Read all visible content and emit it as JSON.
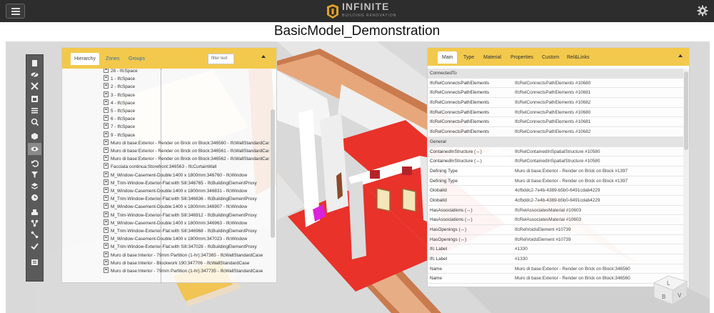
{
  "app": {
    "logo_text": "INFINITE",
    "logo_sub": "BUILDING RENOVATION",
    "menu_icon": "hamburger-icon",
    "settings_icon": "gear-icon"
  },
  "page_title": "BasicModel_Demonstration",
  "colors": {
    "accent": "#f2c94c",
    "topbar": "#2d2d2d",
    "toolbar": "#5a5a5a",
    "link": "#2d6ea8"
  },
  "toolbar": {
    "icons": [
      "document-icon",
      "eye-slash-icon",
      "cross-arrows-icon",
      "window-icon",
      "list-icon",
      "zoom-icon",
      "cube-icon",
      "eye-icon",
      "undo-icon",
      "filter-icon",
      "layers-icon",
      "clock-icon",
      "structure-icon",
      "share-icon",
      "connect-icon",
      "check-icon",
      "export-icon"
    ]
  },
  "left_panel": {
    "tabs": [
      {
        "label": "Hierarchy"
      },
      {
        "label": "Zones"
      },
      {
        "label": "Groups"
      }
    ],
    "filter_placeholder": "filter text",
    "tree": [
      "28 - IfcSpace",
      "1 - IfcSpace",
      "2 - IfcSpace",
      "3 - IfcSpace",
      "4 - IfcSpace",
      "5 - IfcSpace",
      "6 - IfcSpace",
      "7 - IfcSpace",
      "9 - IfcSpace",
      "Muro di base:Exterior - Render on Brick on Block:346560 - IfcWallStandardCase",
      "Muro di base:Exterior - Render on Brick on Block:346561 - IfcWallStandardCase",
      "Muro di base:Exterior - Render on Brick on Block:346562 - IfcWallStandardCase",
      "Facciata continua:Storefront:346563 - IfcCurtainWall",
      "M_Window-Casement-Double:1400 x 1800mm:346760 - IfcWindow",
      "M_Trim-Window-Exterior-Flat:with Sill:346765 - IfcBuildingElementProxy",
      "M_Window-Casement-Double:1400 x 1800mm:346831 - IfcWindow",
      "M_Trim-Window-Exterior-Flat:with Sill:346836 - IfcBuildingElementProxy",
      "M_Window-Casement-Double:1400 x 1800mm:346907 - IfcWindow",
      "M_Trim-Window-Exterior-Flat:with Sill:346912 - IfcBuildingElementProxy",
      "M_Window-Casement-Double:1400 x 1800mm:346963 - IfcWindow",
      "M_Trim-Window-Exterior-Flat:with Sill:346968 - IfcBuildingElementProxy",
      "M_Window-Casement-Double:1400 x 1800mm:347023 - IfcWindow",
      "M_Trim-Window-Exterior-Flat:with Sill:347028 - IfcBuildingElementProxy",
      "Muro di base:Interior - 79mm Partition (1-hr):347365 - IfcWallStandardCase",
      "Muro di base:Interior - Blockwork 190:347706 - IfcWallStandardCase",
      "Muro di base:Interior - 79mm Partition (1-hr):347735 - IfcWallStandardCase"
    ]
  },
  "right_panel": {
    "tabs": [
      {
        "label": "Main"
      },
      {
        "label": "Type"
      },
      {
        "label": "Material"
      },
      {
        "label": "Properties"
      },
      {
        "label": "Custom"
      },
      {
        "label": "Rel&Links"
      }
    ],
    "rows": [
      {
        "section": "ConnectedTo"
      },
      {
        "key": "IfcRelConnectsPathElements",
        "value": "IfcRelConnectsPathElements #10680"
      },
      {
        "key": "IfcRelConnectsPathElements",
        "value": "IfcRelConnectsPathElements #10681"
      },
      {
        "key": "IfcRelConnectsPathElements",
        "value": "IfcRelConnectsPathElements #10682"
      },
      {
        "key": "IfcRelConnectsPathElements",
        "value": "IfcRelConnectsPathElements #10680"
      },
      {
        "key": "IfcRelConnectsPathElements",
        "value": "IfcRelConnectsPathElements #10681"
      },
      {
        "key": "IfcRelConnectsPathElements",
        "value": "IfcRelConnectsPathElements #10682"
      },
      {
        "section": "General"
      },
      {
        "key": "ContainedInStructure (↔)",
        "value": "IfcRelContainedInSpatialStructure #10580"
      },
      {
        "key": "ContainedInStructure (↔)",
        "value": "IfcRelContainedInSpatialStructure #10580"
      },
      {
        "key": "Defining Type",
        "value": "Muro di base:Exterior - Render on Brick on Block #1397"
      },
      {
        "key": "Defining Type",
        "value": "Muro di base:Exterior - Render on Brick on Block #1397"
      },
      {
        "key": "GlobalId",
        "value": "4cfbddc2-7e4b-4389-b5b0-6491cdab4229"
      },
      {
        "key": "GlobalId",
        "value": "4cfbddc2-7e4b-4389-b5b0-6491cdab4229"
      },
      {
        "key": "HasAssociations (↔)",
        "value": "IfcRelAssociatesMaterial #10603"
      },
      {
        "key": "HasAssociations (↔)",
        "value": "IfcRelAssociatesMaterial #10603"
      },
      {
        "key": "HasOpenings (↔)",
        "value": "IfcRelVoidsElement #10739"
      },
      {
        "key": "HasOpenings (↔)",
        "value": "IfcRelVoidsElement #10739"
      },
      {
        "key": "Ifc Label",
        "value": "#1330"
      },
      {
        "key": "Ifc Label",
        "value": "#1330"
      },
      {
        "key": "Name",
        "value": "Muro di base:Exterior - Render on Brick on Block:346560"
      },
      {
        "key": "Name",
        "value": "Muro di base:Exterior - Render on Brick on Block:346560"
      }
    ]
  },
  "view_cube": {
    "faces": [
      "L",
      "B",
      "V"
    ]
  }
}
